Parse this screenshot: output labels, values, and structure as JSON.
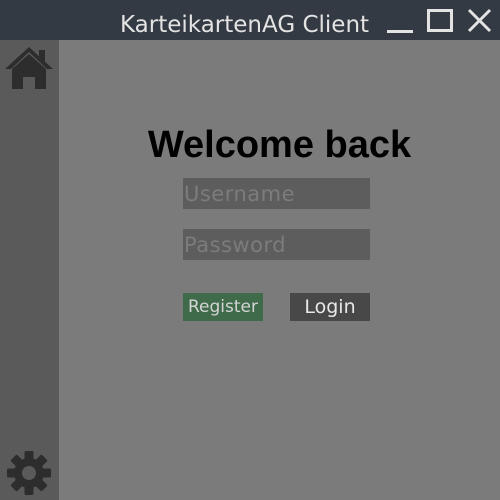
{
  "window": {
    "title": "KarteikartenAG Client",
    "controls": {
      "minimize_icon": "minimize-icon",
      "maximize_icon": "maximize-icon",
      "close_icon": "close-icon"
    }
  },
  "sidebar": {
    "top_icon": "home-icon",
    "bottom_icon": "gear-icon"
  },
  "login": {
    "heading": "Welcome back",
    "username_placeholder": "Username",
    "username_value": "",
    "password_placeholder": "Password",
    "password_value": "",
    "register_label": "Register",
    "login_label": "Login"
  },
  "colors": {
    "titlebar": "#343a44",
    "sidebar": "#5a5a5a",
    "background": "#7b7b7b",
    "input_background": "#5d5d5d",
    "register_button": "#3f6b4b",
    "login_button": "#484848"
  }
}
